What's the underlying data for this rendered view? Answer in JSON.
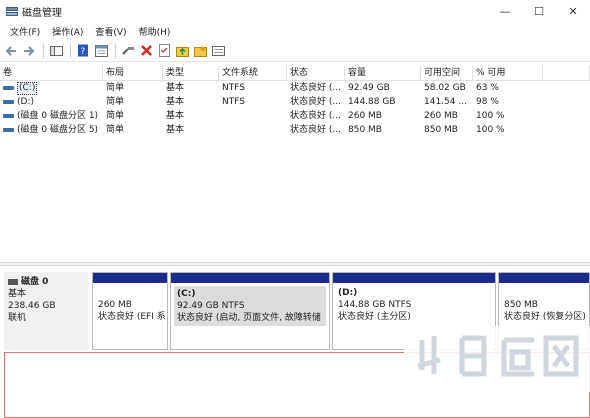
{
  "window": {
    "title": "磁盘管理",
    "controls": {
      "minimize": "—",
      "maximize": "☐",
      "close": "✕"
    }
  },
  "menu": [
    "文件(F)",
    "操作(A)",
    "查看(V)",
    "帮助(H)"
  ],
  "toolbar": [
    "back-icon",
    "forward-icon",
    "console-tree-icon",
    "help-icon",
    "properties-icon",
    "connect-icon",
    "delete-icon",
    "checklist-icon",
    "folder-up-icon",
    "folder-star-icon",
    "view-icon"
  ],
  "volume_table": {
    "headers": [
      "卷",
      "布局",
      "类型",
      "文件系统",
      "状态",
      "容量",
      "可用空间",
      "% 可用"
    ],
    "rows": [
      {
        "volume": "(C:)",
        "layout": "简单",
        "type": "基本",
        "fs": "NTFS",
        "status": "状态良好 (...",
        "capacity": "92.49 GB",
        "free": "58.02 GB",
        "pct": "63 %"
      },
      {
        "volume": "(D:)",
        "layout": "简单",
        "type": "基本",
        "fs": "NTFS",
        "status": "状态良好 (...",
        "capacity": "144.88 GB",
        "free": "141.54 ...",
        "pct": "98 %"
      },
      {
        "volume": "(磁盘 0 磁盘分区 1)",
        "layout": "简单",
        "type": "基本",
        "fs": "",
        "status": "状态良好 (...",
        "capacity": "260 MB",
        "free": "260 MB",
        "pct": "100 %"
      },
      {
        "volume": "(磁盘 0 磁盘分区 5)",
        "layout": "简单",
        "type": "基本",
        "fs": "",
        "status": "状态良好 (...",
        "capacity": "850 MB",
        "free": "850 MB",
        "pct": "100 %"
      }
    ]
  },
  "disk0": {
    "name": "磁盘 0",
    "type": "基本",
    "size": "238.46 GB",
    "status": "联机",
    "partitions": [
      {
        "name": "",
        "size": "260 MB",
        "status": "状态良好 (EFI 系"
      },
      {
        "name": "(C:)",
        "size": "92.49 GB NTFS",
        "status": "状态良好 (启动, 页面文件, 故障转储"
      },
      {
        "name": "(D:)",
        "size": "144.88 GB NTFS",
        "status": "状态良好 (主分区)"
      },
      {
        "name": "",
        "size": "850 MB",
        "status": "状态良好 (恢复分区)"
      }
    ]
  },
  "colors": {
    "partition_header": "#1d2c8c",
    "drive_icon": "#3b6da8"
  }
}
